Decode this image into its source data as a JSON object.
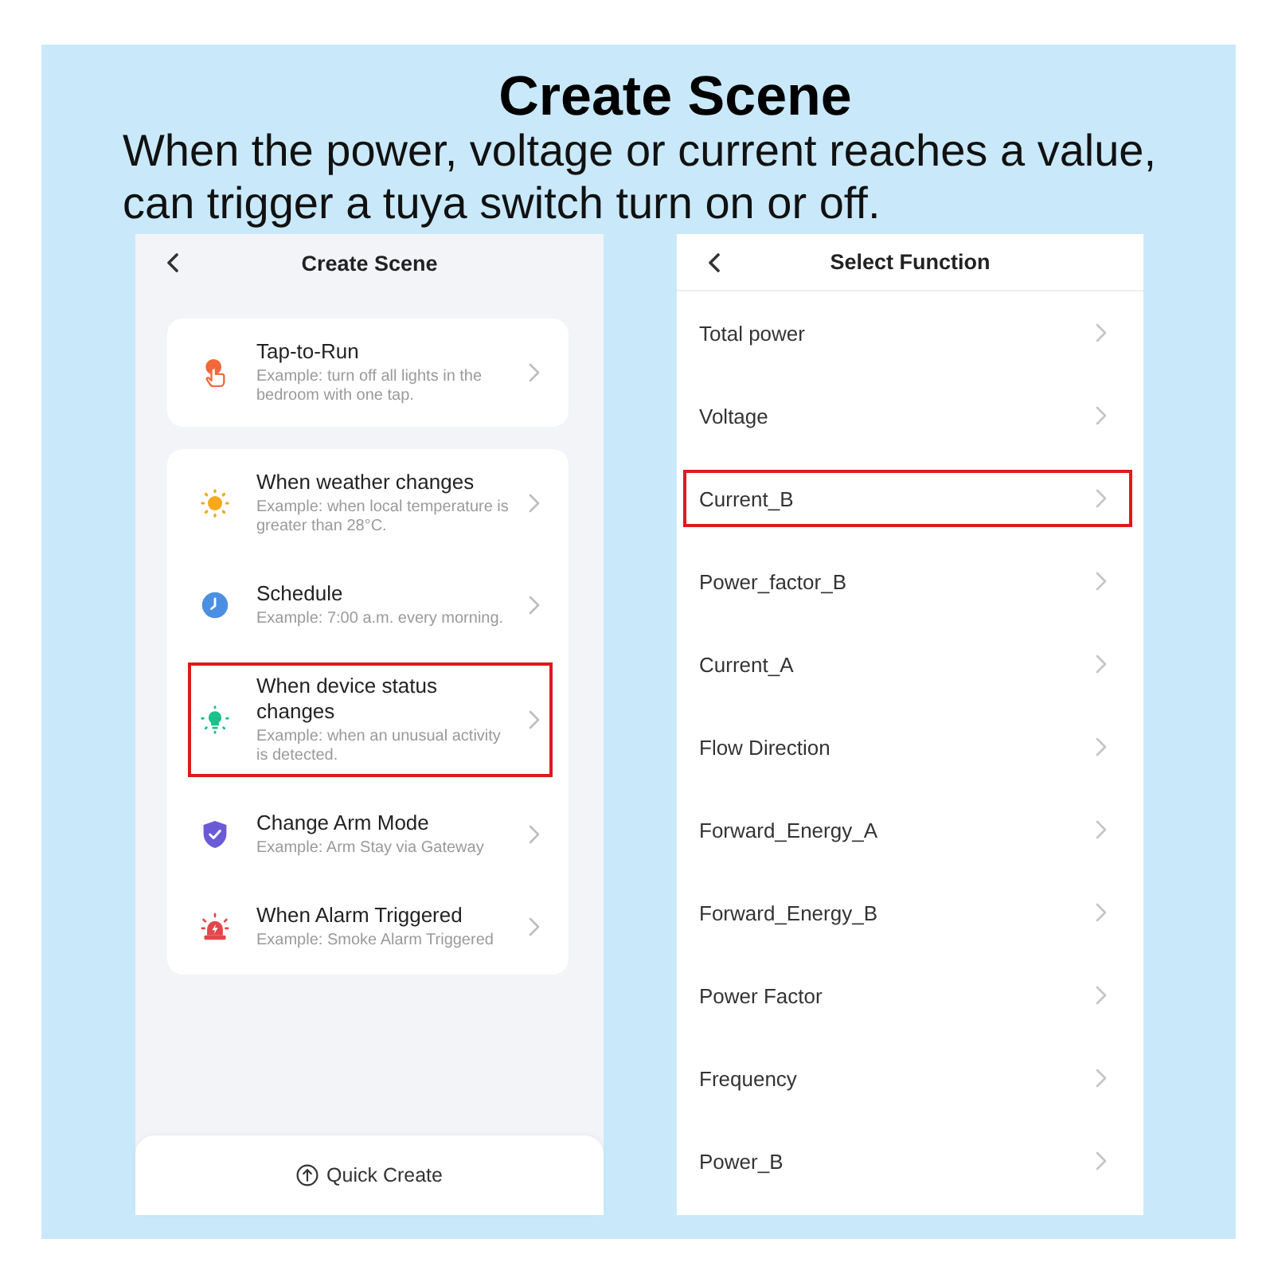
{
  "banner": {
    "title": "Create Scene",
    "caption": "When the power, voltage or current reaches a value, can trigger a tuya switch turn on or off."
  },
  "left_screen": {
    "title": "Create Scene",
    "groups": [
      {
        "items": [
          {
            "kind": "tap",
            "title": "Tap-to-Run",
            "example": "Example: turn off all lights in the bedroom with one tap.",
            "highlighted": false
          }
        ]
      },
      {
        "items": [
          {
            "kind": "weather",
            "title": "When weather changes",
            "example": "Example: when local temperature is greater than 28°C.",
            "highlighted": false
          },
          {
            "kind": "schedule",
            "title": "Schedule",
            "example": "Example: 7:00 a.m. every morning.",
            "highlighted": false
          },
          {
            "kind": "device",
            "title": "When device status changes",
            "example": "Example: when an unusual activity is detected.",
            "highlighted": true
          },
          {
            "kind": "arm",
            "title": "Change Arm Mode",
            "example": "Example: Arm Stay via Gateway",
            "highlighted": false
          },
          {
            "kind": "alarm",
            "title": "When Alarm Triggered",
            "example": "Example: Smoke Alarm Triggered",
            "highlighted": false
          }
        ]
      }
    ],
    "bottom_button": "Quick Create"
  },
  "right_screen": {
    "title": "Select Function",
    "items": [
      {
        "label": "Total power",
        "highlighted": false
      },
      {
        "label": "Voltage",
        "highlighted": false
      },
      {
        "label": "Current_B",
        "highlighted": true
      },
      {
        "label": "Power_factor_B",
        "highlighted": false
      },
      {
        "label": "Current_A",
        "highlighted": false
      },
      {
        "label": "Flow Direction",
        "highlighted": false
      },
      {
        "label": "Forward_Energy_A",
        "highlighted": false
      },
      {
        "label": "Forward_Energy_B",
        "highlighted": false
      },
      {
        "label": "Power Factor",
        "highlighted": false
      },
      {
        "label": "Frequency",
        "highlighted": false
      },
      {
        "label": "Power_B",
        "highlighted": false
      }
    ]
  }
}
